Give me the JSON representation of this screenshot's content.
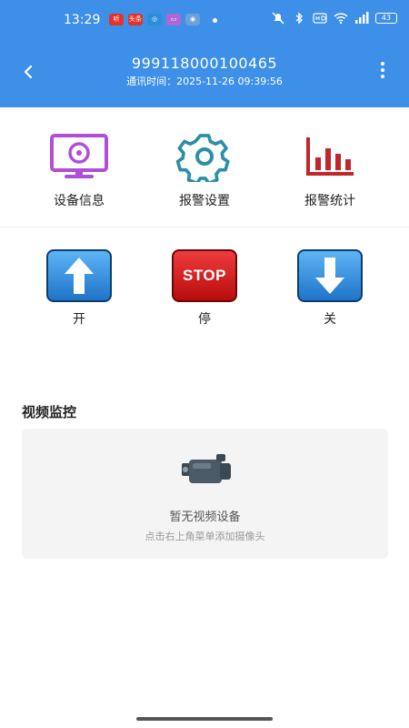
{
  "statusbar": {
    "time": "13:29",
    "battery": "43",
    "apps": [
      {
        "text": "听",
        "color": "#e2342a"
      },
      {
        "text": "头条",
        "color": "#e2342a"
      },
      {
        "text": "◎",
        "color": "#2a8fd8"
      },
      {
        "text": "▭",
        "color": "#b066d6"
      },
      {
        "text": "◉",
        "color": "#6aa0dc"
      }
    ]
  },
  "header": {
    "title": "999118000100465",
    "subtitle": "通讯时间：2025-11-26 09:39:56",
    "color": "#3d8fe8"
  },
  "functions": {
    "device_info": "设备信息",
    "alarm_settings": "报警设置",
    "alarm_stats": "报警统计",
    "icon_color_purple": "#b04fd6",
    "icon_color_teal": "#2b8fa8",
    "icon_color_red": "#c0262c"
  },
  "controls": {
    "open_label": "开",
    "stop_label": "停",
    "stop_text": "STOP",
    "close_label": "关"
  },
  "video": {
    "section_title": "视频监控",
    "empty_title": "暂无视频设备",
    "empty_hint": "点击右上角菜单添加摄像头"
  }
}
